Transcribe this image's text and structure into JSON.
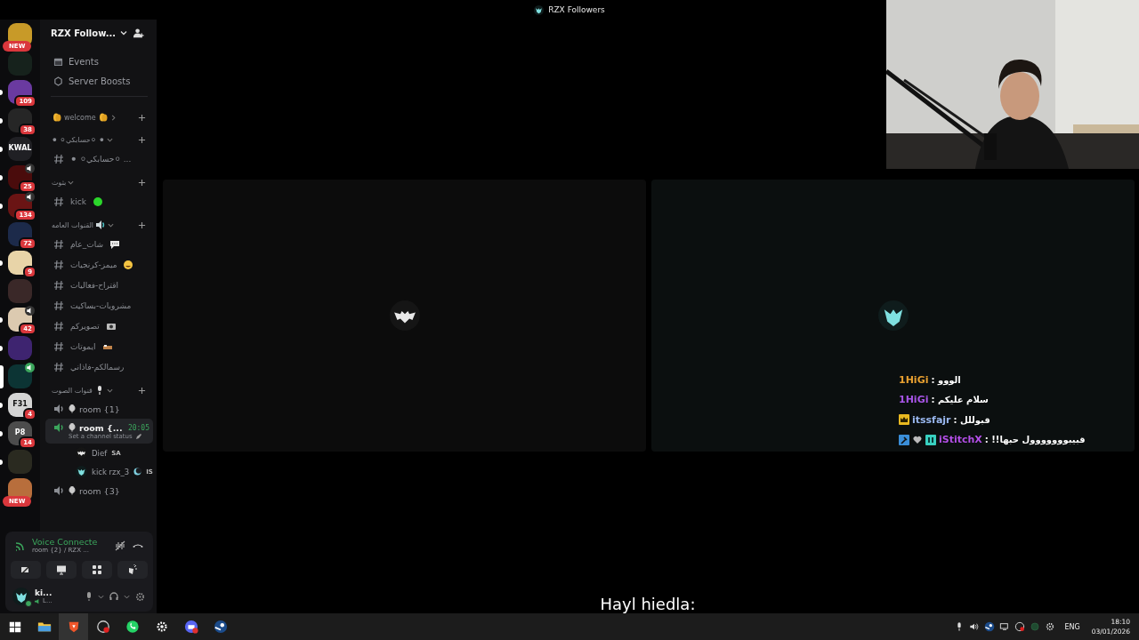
{
  "window": {
    "title": "RZX Followers"
  },
  "servers": [
    {
      "color": "#c89a28",
      "new_label": "NEW",
      "unread": false,
      "voice": false,
      "selected": false
    },
    {
      "color": "#16221c",
      "unread": false,
      "voice": false,
      "selected": false
    },
    {
      "color": "#6a3aa0",
      "badge": "109",
      "unread": true,
      "voice": false,
      "selected": false
    },
    {
      "color": "#262626",
      "badge": "38",
      "unread": true,
      "voice": false,
      "selected": false
    },
    {
      "color": "#202024",
      "label": "KWAL",
      "unread": true,
      "voice": false,
      "selected": false
    },
    {
      "color": "#4a0c0c",
      "badge": "25",
      "unread": true,
      "voice": true,
      "selected": false
    },
    {
      "color": "#6a1414",
      "badge": "134",
      "unread": true,
      "voice": true,
      "selected": false
    },
    {
      "color": "#1c2a4a",
      "badge": "72",
      "unread": false,
      "voice": false,
      "selected": false
    },
    {
      "color": "#e8d4a8",
      "badge": "9",
      "unread": true,
      "voice": false,
      "selected": false
    },
    {
      "color": "#3a2828",
      "unread": false,
      "voice": false,
      "selected": false
    },
    {
      "color": "#dccab0",
      "badge": "42",
      "unread": true,
      "voice": true,
      "selected": false
    },
    {
      "color": "#3e2470",
      "unread": true,
      "voice": false,
      "selected": false
    },
    {
      "color": "#0c3434",
      "unread": false,
      "voice": true,
      "selected": true
    },
    {
      "color": "#d4d4d4",
      "label": "F31",
      "badge": "4",
      "unread": true,
      "voice": false,
      "selected": false
    },
    {
      "color": "#4c4c4c",
      "label": "P8",
      "badge": "14",
      "unread": true,
      "voice": false,
      "selected": false
    },
    {
      "color": "#2a2a20",
      "unread": true,
      "voice": false,
      "selected": false
    },
    {
      "color": "#b86e3c",
      "new_label": "NEW",
      "unread": false,
      "voice": false,
      "selected": false
    }
  ],
  "server_header": {
    "name": "RZX Follow..."
  },
  "menu": [
    {
      "kind": "events",
      "label": "Events"
    },
    {
      "kind": "boosts",
      "label": "Server Boosts"
    }
  ],
  "categories": [
    {
      "name": "welcome",
      "emoji": {
        "kind": "clap"
      },
      "expanded": false
    },
    {
      "name": "⚫ ⚪حسابكي⚪ ⚫",
      "expanded": true,
      "channels": [
        {
          "kind": "text",
          "name": "⚫ ⚪حسابكي⚪ ...",
          "selected": false
        }
      ]
    },
    {
      "name": "بثوث",
      "expanded": true,
      "channels": [
        {
          "kind": "text",
          "name": "kick",
          "emoji": {
            "kind": "green-dot"
          },
          "selected": false
        }
      ]
    },
    {
      "name": "القنوات العامه",
      "emoji": {
        "kind": "speaker"
      },
      "expanded": true,
      "channels": [
        {
          "kind": "text",
          "name": "شات_عام",
          "emoji": {
            "kind": "speech"
          },
          "selected": false
        },
        {
          "kind": "text",
          "name": "ميمز-كرنجيات",
          "emoji": {
            "kind": "laugh"
          },
          "selected": false
        },
        {
          "kind": "text",
          "name": "اقتراح-فعاليات",
          "selected": false
        },
        {
          "kind": "text",
          "name": "مشروبات-بساكيت",
          "selected": false
        },
        {
          "kind": "text",
          "name": "تصويركم",
          "emoji": {
            "kind": "camera"
          },
          "selected": false
        },
        {
          "kind": "text",
          "name": "ايموتات",
          "emoji": {
            "kind": "bed"
          },
          "selected": false
        },
        {
          "kind": "text",
          "name": "رسمالكم-فاذاني",
          "selected": false
        }
      ]
    },
    {
      "name": "قنوات الصوت",
      "emoji": {
        "kind": "mic"
      },
      "expanded": true,
      "channels": [
        {
          "kind": "voice",
          "name": "room {1}",
          "selected": false
        },
        {
          "kind": "voice",
          "name": "room {...",
          "selected": true,
          "timer": "20:05",
          "status": "Set a channel status",
          "users": [
            {
              "name": "Dief",
              "tag": "SA",
              "avatar": {
                "kind": "bat"
              }
            },
            {
              "name": "kick rzx_3",
              "tag": "IS",
              "avatar": {
                "kind": "mask"
              }
            }
          ]
        },
        {
          "kind": "voice",
          "name": "room {3}",
          "selected": false
        }
      ]
    }
  ],
  "voice_panel": {
    "status": "Voice Connecte",
    "channel": "room {2} / RZX ..."
  },
  "user_panel": {
    "name": "ki...",
    "activity": "L..."
  },
  "tiles": [
    {
      "avatar": {
        "kind": "bat"
      }
    },
    {
      "avatar": {
        "kind": "mask"
      }
    }
  ],
  "chat": [
    {
      "user": "1HiGi",
      "color": "#e8a030",
      "message": "الووو :"
    },
    {
      "user": "1HiGi",
      "color": "#a855e8",
      "message": "سلام عليكم :"
    },
    {
      "user": "itssfajr",
      "color": "#9ab8f0",
      "message": "قبوللل :",
      "badges": [
        {
          "kind": "crown"
        }
      ]
    },
    {
      "user": "iStitchX",
      "color": "#b44fe8",
      "message": "قبيبووووووول حبها!! :",
      "badges": [
        {
          "kind": "hammer"
        },
        {
          "kind": "heart"
        },
        {
          "kind": "controller"
        }
      ]
    }
  ],
  "subtitle": "Hayl hiedla:",
  "taskbar": {
    "apps": [
      {
        "kind": "start",
        "selected": false
      },
      {
        "kind": "files",
        "selected": false
      },
      {
        "kind": "browser",
        "selected": true
      },
      {
        "kind": "recorder",
        "selected": false
      },
      {
        "kind": "whatsapp",
        "selected": false
      },
      {
        "kind": "steelseries",
        "selected": false
      },
      {
        "kind": "discord",
        "selected": false
      },
      {
        "kind": "steam",
        "selected": false
      }
    ],
    "tray": [
      {
        "kind": "mic"
      },
      {
        "kind": "volume"
      },
      {
        "kind": "steam"
      },
      {
        "kind": "network"
      },
      {
        "kind": "recorder"
      },
      {
        "kind": "status"
      },
      {
        "kind": "gear"
      }
    ],
    "language": "ENG",
    "time": "18:10",
    "date": "03/01/2026"
  }
}
